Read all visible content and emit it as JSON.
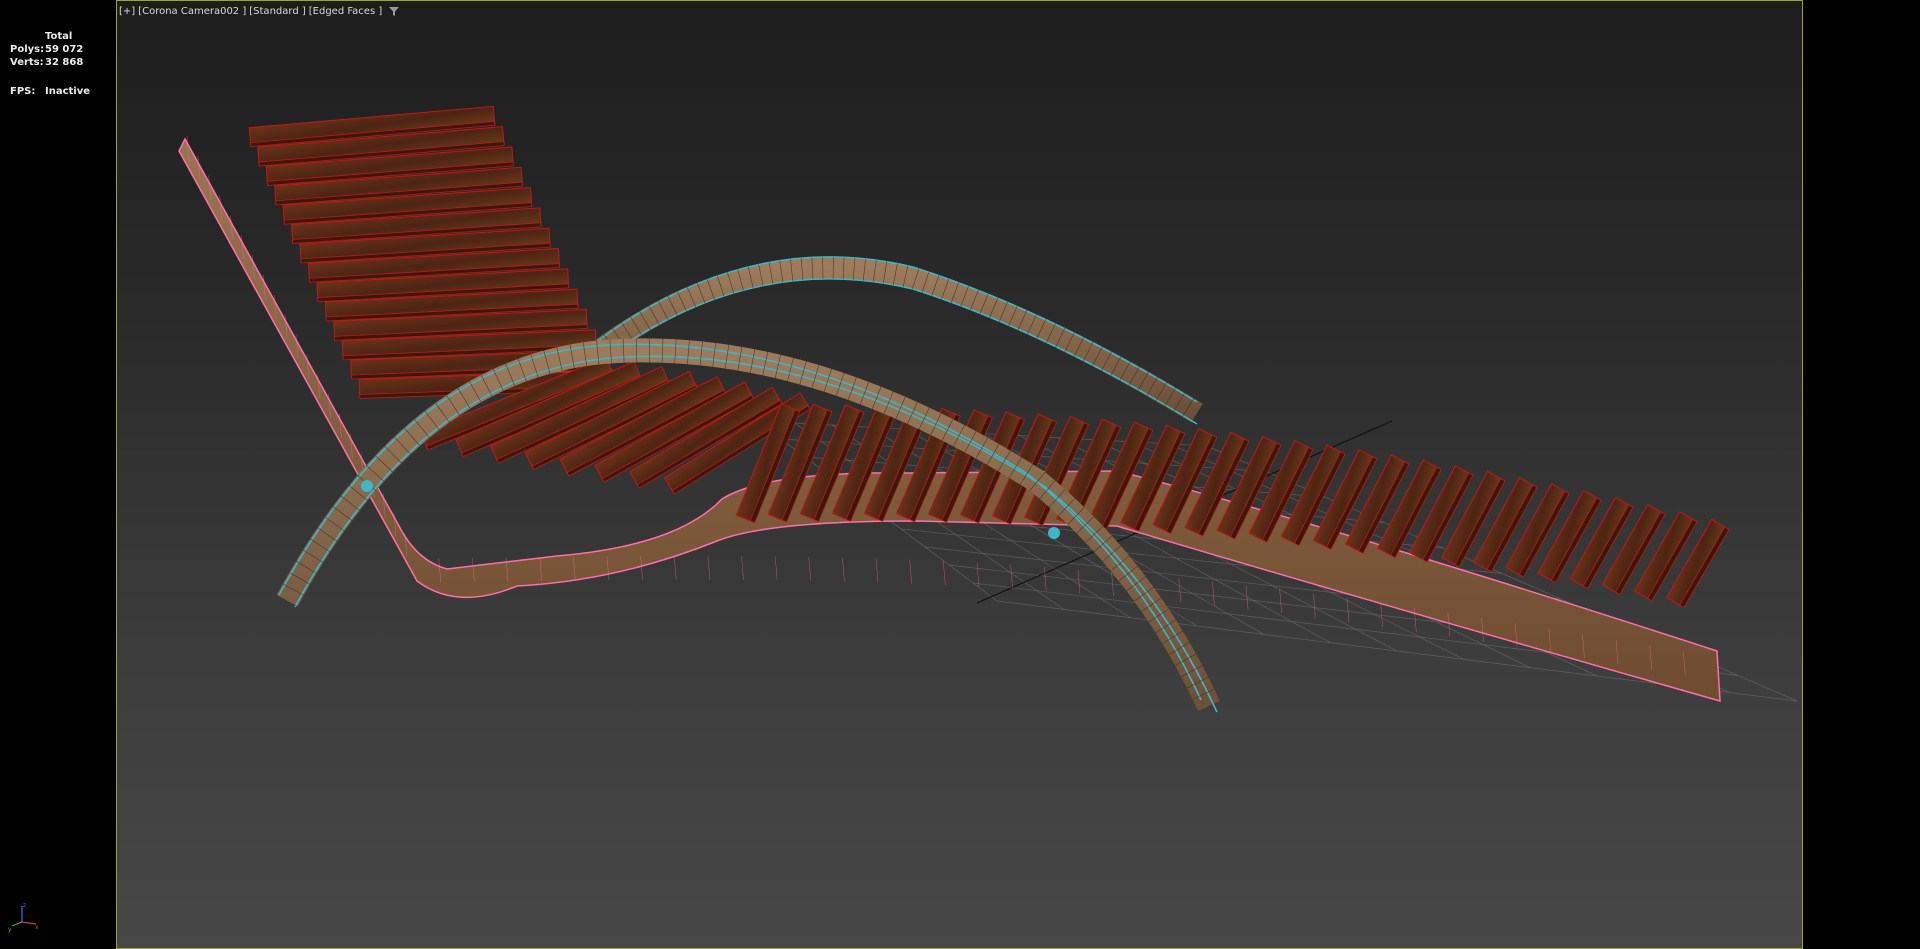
{
  "viewport": {
    "menu_label": "[+]",
    "camera_label": "[Corona Camera002 ]",
    "shading_label": "[Standard ]",
    "edged_faces_label": "[Edged Faces ]",
    "filter_icon": "filter-icon",
    "border_color": "#9aa632"
  },
  "stats": {
    "header": "Total",
    "polys_label": "Polys:",
    "polys_value": "59 072",
    "verts_label": "Verts:",
    "verts_value": "32 868",
    "fps_label": "FPS:",
    "fps_value": "Inactive"
  },
  "axis_gizmo": {
    "x": "x",
    "y": "y",
    "z": "z"
  },
  "colors": {
    "wood": "#5a2a14",
    "selected_frame": "#ff6fa8",
    "arc_selection": "#3fb6c8",
    "slat_wire": "#c01818",
    "grid": "#6d6d6d"
  }
}
